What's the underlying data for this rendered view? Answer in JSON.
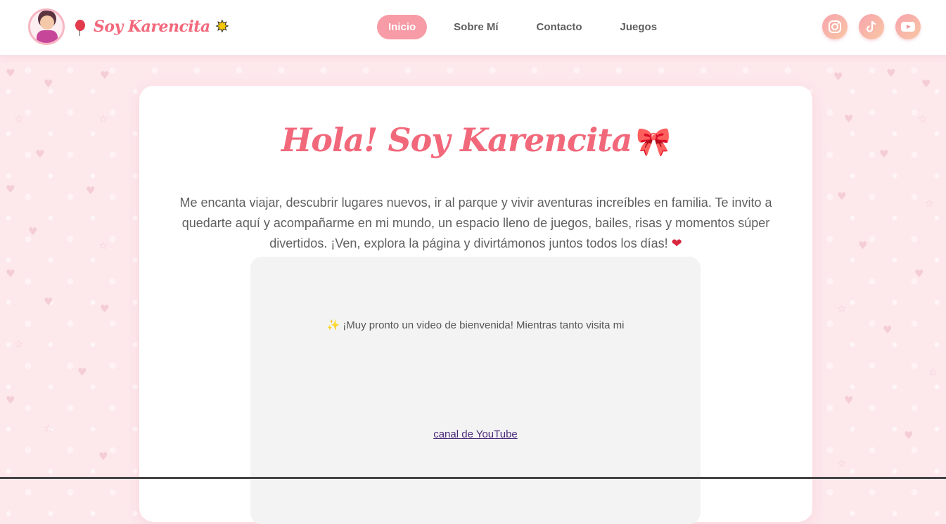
{
  "brand": {
    "title": "Soy Karencita"
  },
  "nav": {
    "items": [
      {
        "label": "Inicio",
        "active": true
      },
      {
        "label": "Sobre Mí",
        "active": false
      },
      {
        "label": "Contacto",
        "active": false
      },
      {
        "label": "Juegos",
        "active": false
      }
    ]
  },
  "socials": [
    "instagram-icon",
    "tiktok-icon",
    "youtube-icon"
  ],
  "hero": {
    "title": "Hola! Soy Karencita",
    "intro": "Me encanta viajar, descubrir lugares nuevos, ir al parque y vivir aventuras increíbles en familia. Te invito a quedarte aquí y acompañarme en mi mundo, un espacio lleno de juegos, bailes, risas y momentos súper divertidos. ¡Ven, explora la página y divirtámonos juntos todos los días!"
  },
  "video": {
    "message": "¡Muy pronto un video de bienvenida! Mientras tanto visita mi",
    "link_label": "canal de YouTube"
  },
  "colors": {
    "accent": "#f2687b",
    "nav_active": "#f79ba6",
    "background": "#fde8ec"
  }
}
